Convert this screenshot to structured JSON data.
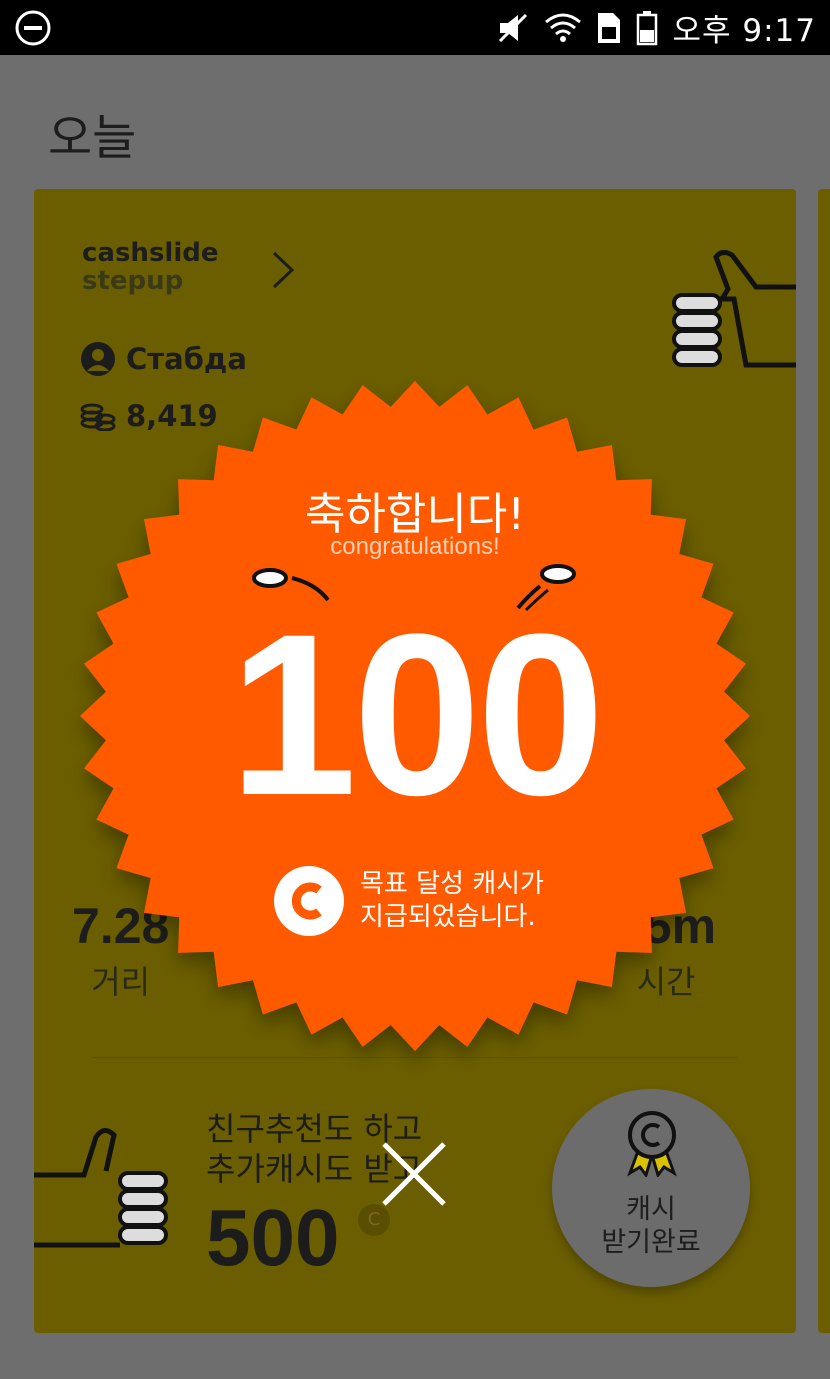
{
  "status_bar": {
    "time": "오후 9:17",
    "icons": [
      "do-not-disturb-icon",
      "vibrate-off-icon",
      "wifi-icon",
      "sim-icon",
      "battery-icon"
    ]
  },
  "page": {
    "title": "오늘"
  },
  "card": {
    "brand_line1": "cashslide",
    "brand_line2": "stepup",
    "user_name": "Стабда",
    "coins": "8,419",
    "distance_value": "7.28",
    "distance_label": "거리",
    "time_value": "25m",
    "time_label": "시간",
    "promo_line1": "친구추천도 하고",
    "promo_line2": "추가캐시도 받고",
    "promo_amount": "500",
    "promo_currency": "C",
    "complete_button_line1": "캐시",
    "complete_button_line2": "받기완료"
  },
  "reward_popup": {
    "title_ko": "축하합니다!",
    "title_en": "congratulations!",
    "amount": "100",
    "message_line1": "목표 달성 캐시가",
    "message_line2": "지급되었습니다."
  },
  "colors": {
    "card_bg": "#6b5e00",
    "overlay_bg": "#6e6e6e",
    "badge_orange": "#ff5a00",
    "status_bar": "#000000"
  }
}
